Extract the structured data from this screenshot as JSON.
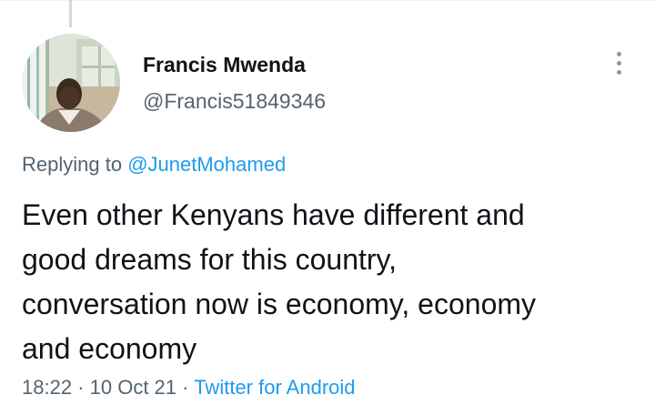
{
  "tweet": {
    "author": {
      "name": "Francis Mwenda",
      "handle": "@Francis51849346",
      "avatar_icon": "profile-photo"
    },
    "more_icon": "more-vertical-icon",
    "reply": {
      "prefix": "Replying to",
      "mention": "@JunetMohamed"
    },
    "text_lines": [
      "Even other Kenyans have different and",
      "good dreams for this country,",
      "conversation now is economy, economy",
      "and economy"
    ],
    "meta": {
      "time": "18:22",
      "separator": "·",
      "date": "10 Oct 21",
      "source": "Twitter for Android"
    },
    "colors": {
      "link": "#1d9bf0",
      "secondary": "#536471",
      "primary": "#0f1419"
    }
  }
}
